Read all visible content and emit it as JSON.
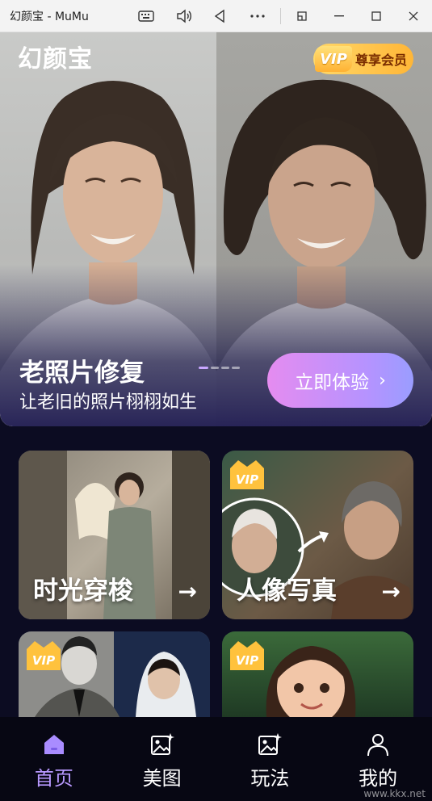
{
  "window": {
    "title": "幻颜宝 - MuMu"
  },
  "app": {
    "logo_text": "幻颜宝"
  },
  "vip": {
    "tag": "VIP",
    "member_label": "尊享会员"
  },
  "hero": {
    "title": "老照片修复",
    "subtitle": "让老旧的照片栩栩如生",
    "cta_label": "立即体验",
    "carousel_pages": 4,
    "carousel_active": 0
  },
  "cards": [
    {
      "label": "时光穿梭",
      "vip": false
    },
    {
      "label": "人像写真",
      "vip": true
    },
    {
      "label": "",
      "vip": true
    },
    {
      "label": "",
      "vip": true
    }
  ],
  "nav": [
    {
      "label": "首页",
      "active": true,
      "icon": "home-icon"
    },
    {
      "label": "美图",
      "active": false,
      "icon": "image-sparkle-icon"
    },
    {
      "label": "玩法",
      "active": false,
      "icon": "image-sparkle-icon"
    },
    {
      "label": "我的",
      "active": false,
      "icon": "user-icon"
    }
  ],
  "watermark": "www.kkx.net",
  "colors": {
    "accent": "#b899ff",
    "vip_gold": "#ffc23d",
    "background": "#0c0c22"
  }
}
